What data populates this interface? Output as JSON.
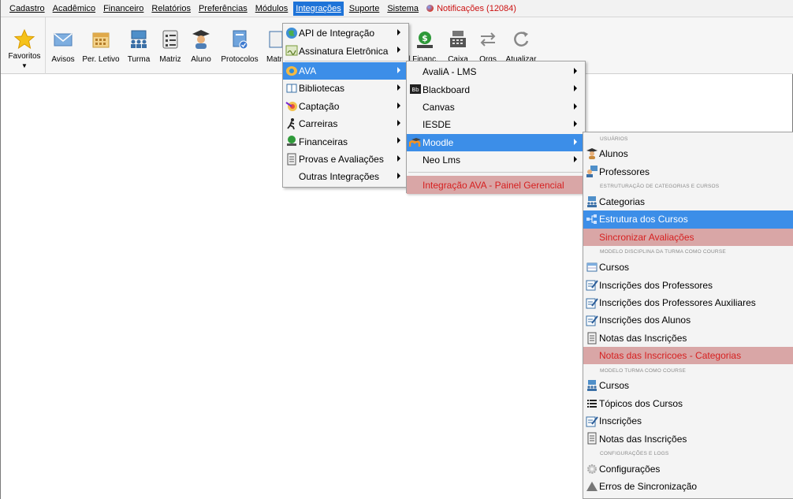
{
  "menubar": {
    "items": [
      "Cadastro",
      "Acadêmico",
      "Financeiro",
      "Relatórios",
      "Preferências",
      "Módulos",
      "Integrações",
      "Suporte",
      "Sistema"
    ],
    "notifications": "Notificações (12084)"
  },
  "toolbar": {
    "buttons": [
      "Favoritos",
      "Avisos",
      "Per. Letivo",
      "Turma",
      "Matriz",
      "Aluno",
      "Protocolos",
      "Matr",
      "l Financ.",
      "Caixa",
      "Orgs",
      "Atualizar"
    ]
  },
  "integracoes_menu": {
    "items": [
      "API de Integração",
      "Assinatura Eletrônica",
      "AVA",
      "Bibliotecas",
      "Captação",
      "Carreiras",
      "Financeiras",
      "Provas e Avaliações",
      "Outras Integrações"
    ]
  },
  "ava_menu": {
    "items": [
      "AvaliA - LMS",
      "Blackboard",
      "Canvas",
      "IESDE",
      "Moodle",
      "Neo Lms"
    ],
    "footer": "Integração AVA - Painel Gerencial"
  },
  "moodle_menu": {
    "header_usuarios": "USUÁRIOS",
    "alunos": "Alunos",
    "professores": "Professores",
    "header_estruturacao": "ESTRUTURAÇÃO DE CATEGORIAS E CURSOS",
    "categorias": "Categorias",
    "estrutura_cursos": "Estrutura dos Cursos",
    "sincronizar_avaliacoes": "Sincronizar Avaliações",
    "header_disciplina": "MODELO DISCIPLINA DA TURMA COMO COURSE",
    "cursos_1": "Cursos",
    "inscricoes_professores": "Inscrições dos Professores",
    "inscricoes_prof_aux": "Inscrições dos Professores Auxiliares",
    "inscricoes_alunos": "Inscrições dos Alunos",
    "notas_inscricoes_1": "Notas das Inscrições",
    "notas_inscricoes_categorias": "Notas das Inscricoes - Categorias",
    "header_turma": "MODELO TURMA COMO COURSE",
    "cursos_2": "Cursos",
    "topicos_cursos": "Tópicos dos Cursos",
    "inscricoes": "Inscrições",
    "notas_inscricoes_2": "Notas das Inscrições",
    "header_config": "CONFIGURAÇÕES E LOGS",
    "configuracoes": "Configurações",
    "erros_sincronizacao": "Erros de Sincronização"
  },
  "colors": {
    "selection": "#3c8ee8",
    "menubar_active": "#1e73d8",
    "highlight_red_bg": "#d9a6a6",
    "highlight_red_text": "#d62020",
    "notification_text": "#cc1111"
  }
}
